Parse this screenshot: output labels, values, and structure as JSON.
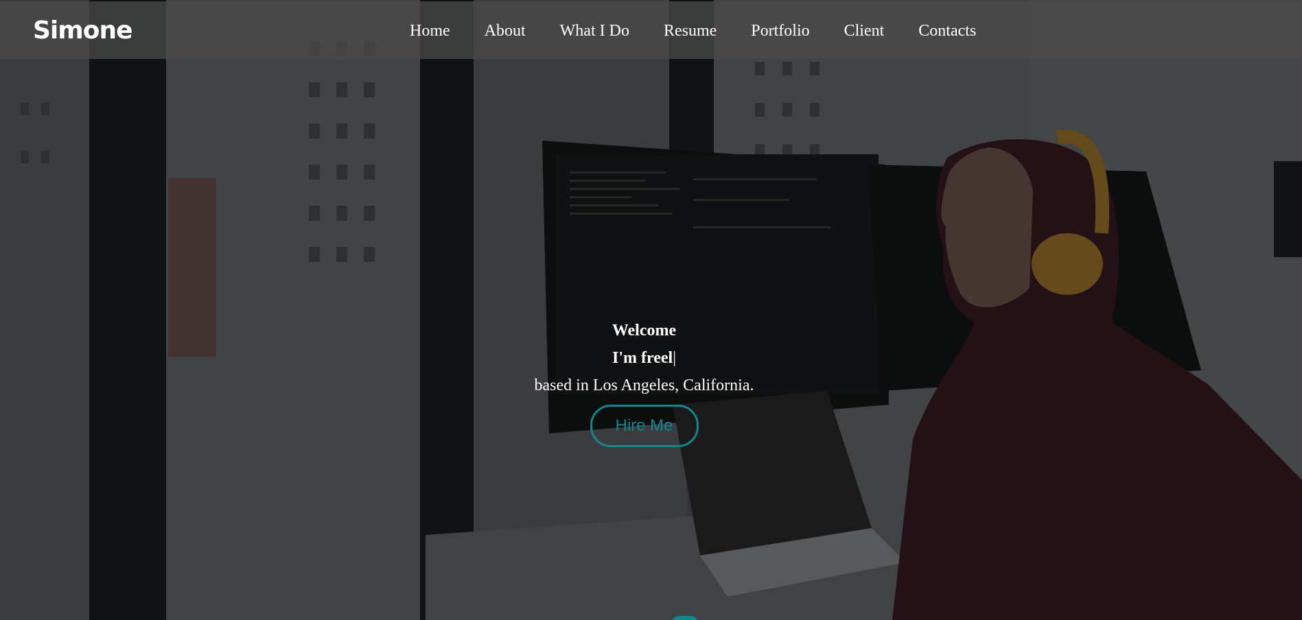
{
  "brand": {
    "logo_text": "Simone"
  },
  "nav": {
    "items": [
      {
        "label": "Home"
      },
      {
        "label": "About"
      },
      {
        "label": "What I Do"
      },
      {
        "label": "Resume"
      },
      {
        "label": "Portfolio"
      },
      {
        "label": "Client"
      },
      {
        "label": "Contacts"
      }
    ]
  },
  "hero": {
    "welcome": "Welcome",
    "typed_text": "I'm freel",
    "caret": "|",
    "location": "based in Los Angeles, California.",
    "cta_label": "Hire Me",
    "background_image": "woman-with-headphones-coding-at-desk-photo"
  },
  "colors": {
    "accent": "#11888f",
    "nav_bg": "rgba(75,75,75,0.72)",
    "text": "#ffffff"
  }
}
